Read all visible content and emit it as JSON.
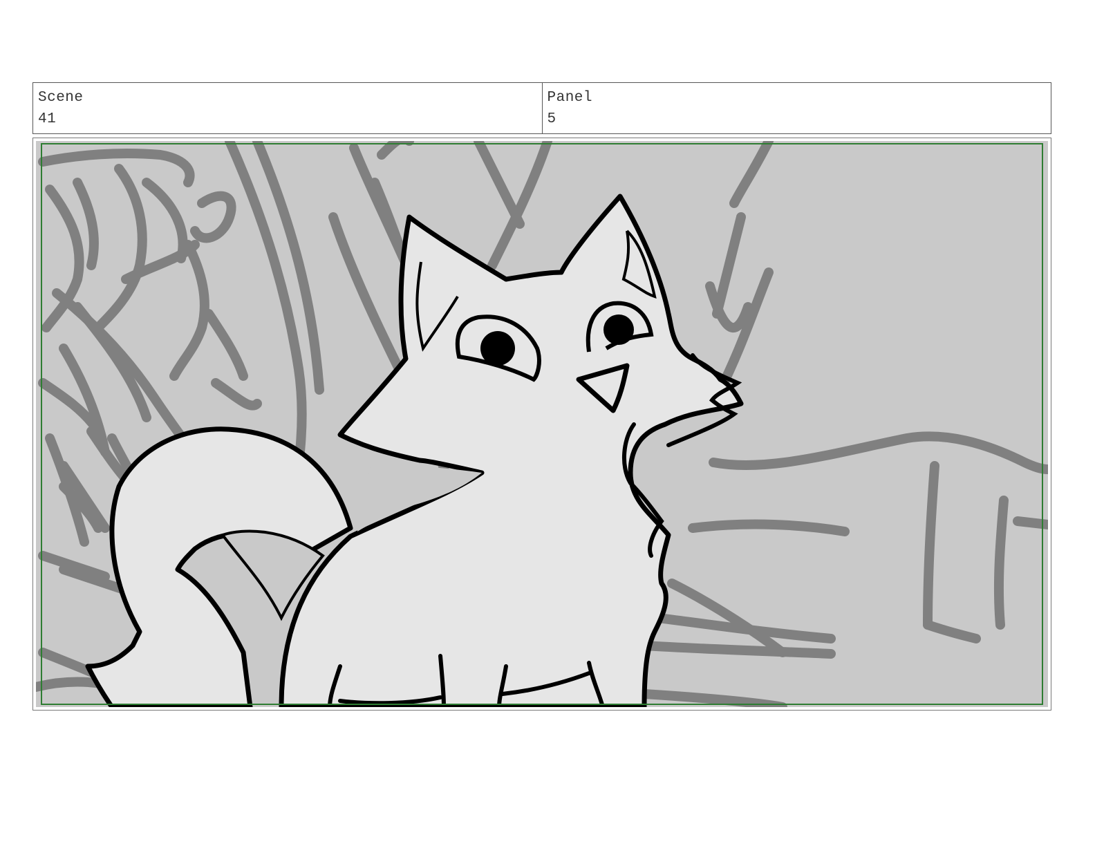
{
  "header": {
    "scene": {
      "label": "Scene",
      "value": "41"
    },
    "panel": {
      "label": "Panel",
      "value": "5"
    }
  },
  "panel_art": {
    "subject": "fox-sketch",
    "colors": {
      "background": "#c9c9c9",
      "background_strokes": "#808080",
      "figure_fill": "#e6e6e6",
      "outline": "#000000",
      "safe_frame": "#2e7d32"
    }
  }
}
